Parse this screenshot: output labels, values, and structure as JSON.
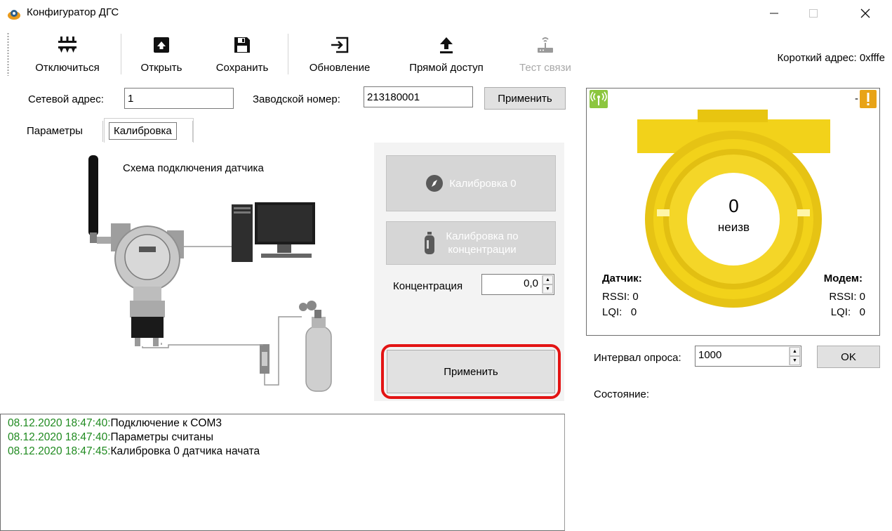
{
  "window": {
    "title": "Конфигуратор ДГС"
  },
  "toolbar": {
    "disconnect": "Отключиться",
    "open": "Открыть",
    "save": "Сохранить",
    "update": "Обновление",
    "direct_access": "Прямой доступ",
    "link_test": "Тест связи",
    "short_address": "Короткий адрес: 0xfffe"
  },
  "settings": {
    "network_address_label": "Сетевой адрес:",
    "network_address_value": "1",
    "serial_number_label": "Заводской номер:",
    "serial_number_value": "213180001",
    "apply_label": "Применить"
  },
  "tabs": [
    {
      "label": "Параметры",
      "active": false
    },
    {
      "label": "Калибровка",
      "active": true
    }
  ],
  "calibration": {
    "schema_title": "Схема подключения датчика",
    "zero_button": "Калибровка 0",
    "conc_button_line1": "Калибровка по",
    "conc_button_line2": "концентрации",
    "concentration_label": "Концентрация",
    "concentration_value": "0,0",
    "apply_button": "Применить"
  },
  "log": [
    {
      "time": "08.12.2020 18:47:40:",
      "message": "Подключение к COM3"
    },
    {
      "time": "08.12.2020 18:47:40:",
      "message": "Параметры считаны"
    },
    {
      "time": "08.12.2020 18:47:45:",
      "message": "Калибровка 0 датчика начата"
    }
  ],
  "monitor": {
    "top_right": "-",
    "value": "0",
    "unit": "неизв",
    "sensor": {
      "title": "Датчик:",
      "rssi": "RSSI: 0",
      "lqi": "LQI:   0"
    },
    "modem": {
      "title": "Модем:",
      "rssi": "RSSI: 0",
      "lqi": "LQI:   0"
    }
  },
  "poll": {
    "label": "Интервал опроса:",
    "value": "1000",
    "ok": "OK",
    "state_label": "Состояние:"
  },
  "colors": {
    "accent_yellow": "#f2d21a",
    "log_timestamp": "#1f8a1f",
    "highlight": "#e31414",
    "signal_green": "#8cc63f",
    "warning_orange": "#e8a317"
  }
}
